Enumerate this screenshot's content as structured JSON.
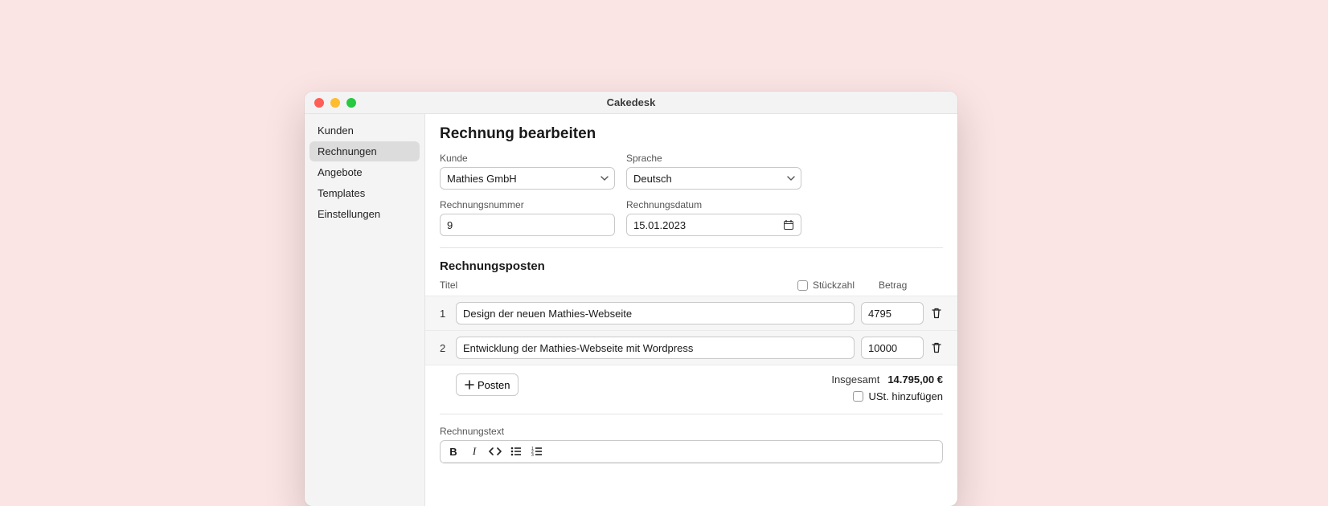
{
  "window": {
    "title": "Cakedesk"
  },
  "sidebar": {
    "items": [
      {
        "label": "Kunden"
      },
      {
        "label": "Rechnungen"
      },
      {
        "label": "Angebote"
      },
      {
        "label": "Templates"
      },
      {
        "label": "Einstellungen"
      }
    ],
    "active_index": 1
  },
  "page": {
    "title": "Rechnung bearbeiten",
    "fields": {
      "customer": {
        "label": "Kunde",
        "value": "Mathies GmbH"
      },
      "language": {
        "label": "Sprache",
        "value": "Deutsch"
      },
      "invoice_number": {
        "label": "Rechnungsnummer",
        "value": "9"
      },
      "invoice_date": {
        "label": "Rechnungsdatum",
        "value": "15.01.2023"
      }
    },
    "line_items_section": {
      "title": "Rechnungsposten",
      "headers": {
        "title": "Titel",
        "qty": "Stückzahl",
        "amount": "Betrag"
      },
      "items": [
        {
          "num": "1",
          "title": "Design der neuen Mathies-Webseite",
          "amount": "4795"
        },
        {
          "num": "2",
          "title": "Entwicklung der Mathies-Webseite mit Wordpress",
          "amount": "10000"
        }
      ],
      "add_label": "Posten",
      "total_label": "Insgesamt",
      "total_value": "14.795,00 €",
      "vat_label": "USt. hinzufügen"
    },
    "invoice_text": {
      "label": "Rechnungstext"
    }
  }
}
